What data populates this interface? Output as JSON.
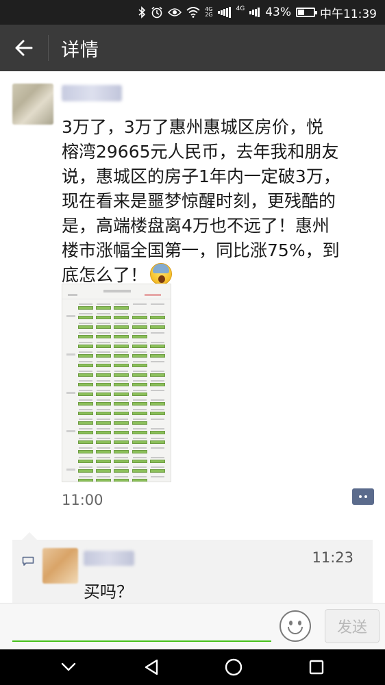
{
  "status_bar": {
    "network_4g": "4G",
    "network_2g": "2G",
    "network_speed": "4G",
    "battery_percent": "43%",
    "battery_level": 0.43,
    "time": "中午11:39",
    "icons": [
      "bluetooth-icon",
      "alarm-icon",
      "eye-icon",
      "wifi-icon",
      "signal-icon",
      "battery-icon"
    ]
  },
  "header": {
    "title": "详情",
    "back_icon": "arrow-left-icon"
  },
  "post": {
    "nickname": "",
    "text": "3万了，3万了惠州惠城区房价，悦\n榕湾29665元人民币，去年我和朋友\n说，惠城区的房子1年内一定破3万，\n现在看来是噩梦惊醒时刻，更残酷的\n是，高端楼盘离4万也不远了！惠州\n楼市涨幅全国第一，同比涨75%，到\n底怎么了！",
    "emoji": "scream-emoji",
    "time": "11:00",
    "comment_icon": "comment-dots-icon"
  },
  "comment": {
    "nickname": "",
    "time": "11:23",
    "text": "买吗？"
  },
  "input_bar": {
    "placeholder": "",
    "send_label": "发送"
  },
  "nav_bar": {
    "icons": [
      "chevron-down-icon",
      "back-triangle-icon",
      "home-circle-icon",
      "recents-square-icon"
    ]
  },
  "colors": {
    "title_bar": "#3a3a3a",
    "status_bar": "#1f1f1f",
    "input_accent": "#45c01a",
    "comment_icon_bg": "#5b6b8c"
  }
}
